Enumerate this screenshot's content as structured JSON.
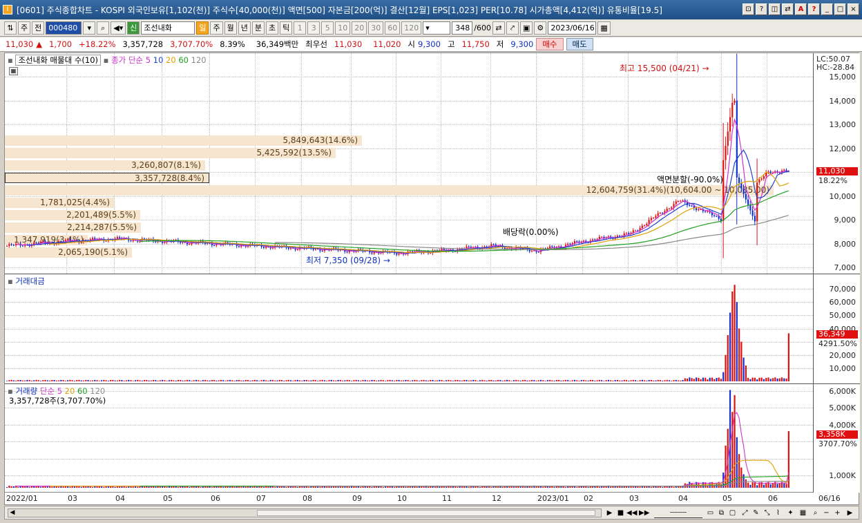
{
  "window": {
    "app_icon": "I",
    "title": "[0601] 주식종합차트 - KOSPI 외국인보유[1,102(천)] 주식수[40,000(천)] 액면[500] 자본금[200(억)] 결산[12월] EPS[1,023] PER[10.78] 시가총액[4,412(억)] 유통비율[19.5]",
    "buttons": [
      "⊡",
      "?",
      "◫",
      "⇄",
      "A",
      "?",
      "_",
      "□",
      "×"
    ]
  },
  "toolbar": {
    "type_label": "주",
    "prev_label": "전",
    "stock_code": "000480",
    "stock_name": "조선내화",
    "new_badge": "신",
    "periods": [
      "일",
      "주",
      "월",
      "년",
      "분",
      "초",
      "틱"
    ],
    "minutes": [
      "1",
      "3",
      "5",
      "10",
      "20",
      "30",
      "60",
      "120"
    ],
    "count": "348",
    "count_max": "/600",
    "date": "2023/06/16"
  },
  "quote": {
    "price": "11,030",
    "up_arrow": "▲",
    "change": "1,700",
    "change_pct": "+18.22%",
    "volume": "3,357,728",
    "volume_ratio": "3,707.70%",
    "turnover": "8.39%",
    "amount": "36,349백만",
    "best_label": "최우선",
    "ask": "11,030",
    "bid": "11,020",
    "open_label": "시",
    "open": "9,300",
    "high_label": "고",
    "high": "11,750",
    "low_label": "저",
    "low": "9,300",
    "buy_label": "매수",
    "sell_label": "매도"
  },
  "price_pane": {
    "legend_vp": "조선내화 매물대 수(10)",
    "legend_ma_label": "종가 단순",
    "ma_periods": [
      "5",
      "10",
      "20",
      "60",
      "120"
    ],
    "ma_colors": [
      "#d030d0",
      "#2040d0",
      "#e0a000",
      "#20a020",
      "#888888"
    ],
    "y_labels": [
      "15,000",
      "14,000",
      "13,000",
      "12,000",
      "11,000",
      "10,000",
      "9,000",
      "8,000",
      "7,000"
    ],
    "lc": "LC:50.07",
    "hc": "HC:-28.84",
    "price_tag": "11,030",
    "change_tag": "18.22%",
    "volume_profile": [
      {
        "label": "5,849,643(14.6%)"
      },
      {
        "label": "5,425,592(13.5%)"
      },
      {
        "label": "3,260,807(8.1%)"
      },
      {
        "label": "3,357,728(8.4%)"
      },
      {
        "label": "12,604,759(31.4%)(10,604.00 ~ 10,085.00)"
      },
      {
        "label": "1,781,025(4.4%)"
      },
      {
        "label": "2,201,489(5.5%)"
      },
      {
        "label": "2,214,287(5.5%)"
      },
      {
        "label": "1,347,919(3.4%)"
      },
      {
        "label": "2,065,190(5.1%)"
      }
    ],
    "annotations": {
      "high": "최고 15,500 (04/21) →",
      "low": "최저 7,350 (09/28) →",
      "dividend": "배당락(0.00%)",
      "split": "액면분할(-90.0%)"
    }
  },
  "amount_pane": {
    "legend": "거래대금",
    "y_labels": [
      "70,000",
      "60,000",
      "50,000",
      "40,000",
      "30,000",
      "20,000",
      "10,000"
    ],
    "tag": "36,349",
    "tag2": "4291.50%"
  },
  "volume_pane": {
    "legend_label": "거래량",
    "legend_ma_label": "단순",
    "ma_periods": [
      "5",
      "20",
      "60",
      "120"
    ],
    "sub": "3,357,728주(3,707.70%)",
    "y_labels": [
      "6,000K",
      "5,000K",
      "4,000K",
      "3,000K",
      "2,000K",
      "1,000K"
    ],
    "tag": "3,358K",
    "tag2": "3707.70%"
  },
  "x_axis": [
    "2022/01",
    "03",
    "04",
    "05",
    "06",
    "07",
    "08",
    "09",
    "10",
    "11",
    "12",
    "2023/01",
    "02",
    "03",
    "04",
    "05",
    "06",
    "06/16"
  ],
  "chart_data": {
    "type": "candlestick",
    "price_series": {
      "name": "조선내화",
      "x": [
        "2022/01",
        "2022/03",
        "2022/04",
        "2022/05",
        "2022/06",
        "2022/07",
        "2022/08",
        "2022/09",
        "2022/10",
        "2022/11",
        "2022/12",
        "2023/01",
        "2023/02",
        "2023/03",
        "2023/04",
        "2023/05",
        "2023/06"
      ],
      "close": [
        7900,
        8100,
        8200,
        8100,
        8000,
        7900,
        7800,
        7700,
        7600,
        7700,
        7900,
        7700,
        8100,
        8400,
        9800,
        9000,
        11030
      ]
    },
    "price_ylim": [
      7000,
      15500
    ],
    "amount_ylim": [
      0,
      75000
    ],
    "volume_ylim": [
      0,
      6000
    ]
  }
}
